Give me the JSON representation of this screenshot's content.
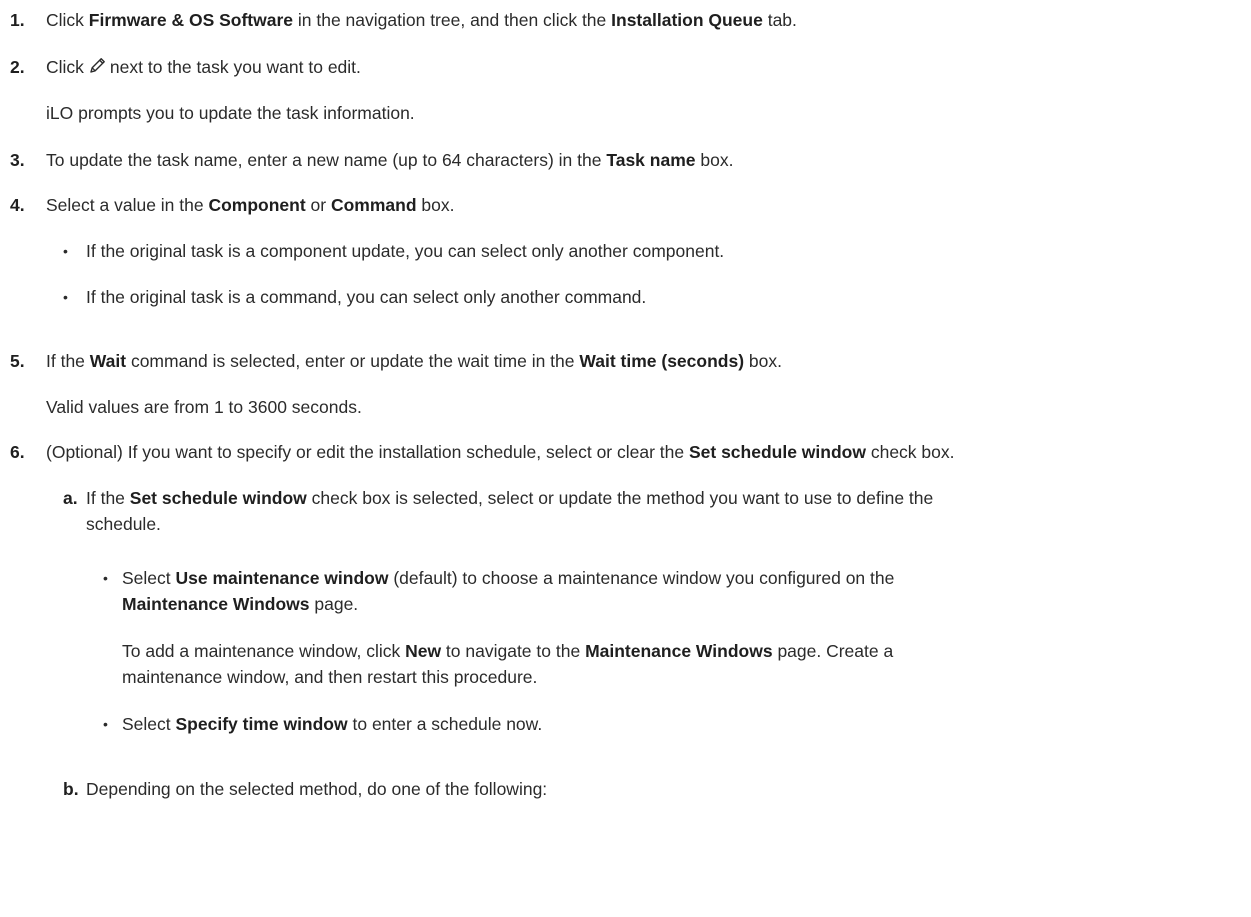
{
  "steps": [
    {
      "num": "1.",
      "parts": [
        "Click ",
        "Firmware & OS Software",
        " in the navigation tree, and then click the ",
        "Installation Queue",
        " tab."
      ]
    },
    {
      "num": "2.",
      "parts": [
        "Click",
        "next to the task you want to edit."
      ],
      "icon": "pencil-icon",
      "note": "iLO prompts you to update the task information."
    },
    {
      "num": "3.",
      "parts": [
        "To update the task name, enter a new name (up to 64 characters) in the ",
        "Task name",
        " box."
      ]
    },
    {
      "num": "4.",
      "parts": [
        "Select a value in the ",
        "Component",
        " or ",
        "Command",
        " box."
      ],
      "bullets": [
        "If the original task is a component update, you can select only another component.",
        "If the original task is a command, you can select only another command."
      ]
    },
    {
      "num": "5.",
      "parts": [
        "If the ",
        "Wait",
        " command is selected, enter or update the wait time in the ",
        "Wait time (seconds)",
        " box."
      ],
      "note": "Valid values are from 1 to 3600 seconds."
    },
    {
      "num": "6.",
      "parts": [
        "(Optional) If you want to specify or edit the installation schedule, select or clear the ",
        "Set schedule window",
        " check box."
      ]
    }
  ],
  "substeps": [
    {
      "letter": "a.",
      "line1": [
        "If the ",
        "Set schedule window",
        " check box is selected, select or update the method you want to use to define the"
      ],
      "line2": "schedule.",
      "bullets": [
        {
          "line1": [
            "Select ",
            "Use maintenance window",
            " (default) to choose a maintenance window you configured on the"
          ],
          "line2": [
            "Maintenance Windows",
            " page."
          ],
          "note1": [
            "To add a maintenance window, click ",
            "New",
            " to navigate to the ",
            "Maintenance Windows",
            " page. Create a"
          ],
          "note2": "maintenance window, and then restart this procedure."
        },
        {
          "line1": [
            "Select ",
            "Specify time window",
            " to enter a schedule now."
          ]
        }
      ]
    },
    {
      "letter": "b.",
      "line1": [
        "Depending on the selected method, do one of the following:"
      ]
    }
  ],
  "bullet_char": "•"
}
